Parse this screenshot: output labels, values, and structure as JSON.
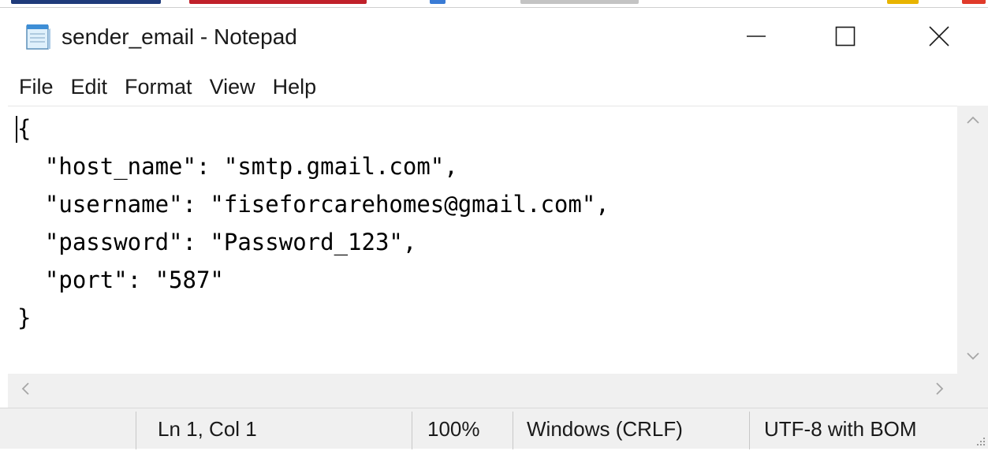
{
  "window": {
    "title": "sender_email - Notepad",
    "app_icon": "notepad-icon",
    "controls": {
      "minimize_icon": "minimize-icon",
      "maximize_icon": "maximize-icon",
      "close_icon": "close-icon"
    }
  },
  "menu": {
    "items": [
      "File",
      "Edit",
      "Format",
      "View",
      "Help"
    ]
  },
  "editor": {
    "lines": [
      "{",
      "  \"host_name\": \"smtp.gmail.com\",",
      "  \"username\": \"fiseforcarehomes@gmail.com\",",
      "  \"password\": \"Password_123\",",
      "  \"port\": \"587\"",
      "}"
    ]
  },
  "scrollbars": {
    "up_icon": "chevron-up-icon",
    "down_icon": "chevron-down-icon",
    "left_icon": "chevron-left-icon",
    "right_icon": "chevron-right-icon"
  },
  "status": {
    "position": "Ln 1, Col 1",
    "zoom": "100%",
    "line_ending": "Windows (CRLF)",
    "encoding": "UTF-8 with BOM"
  },
  "colors": {
    "chrome_background": "#f0f0f0",
    "editor_background": "#ffffff",
    "text": "#000000"
  }
}
